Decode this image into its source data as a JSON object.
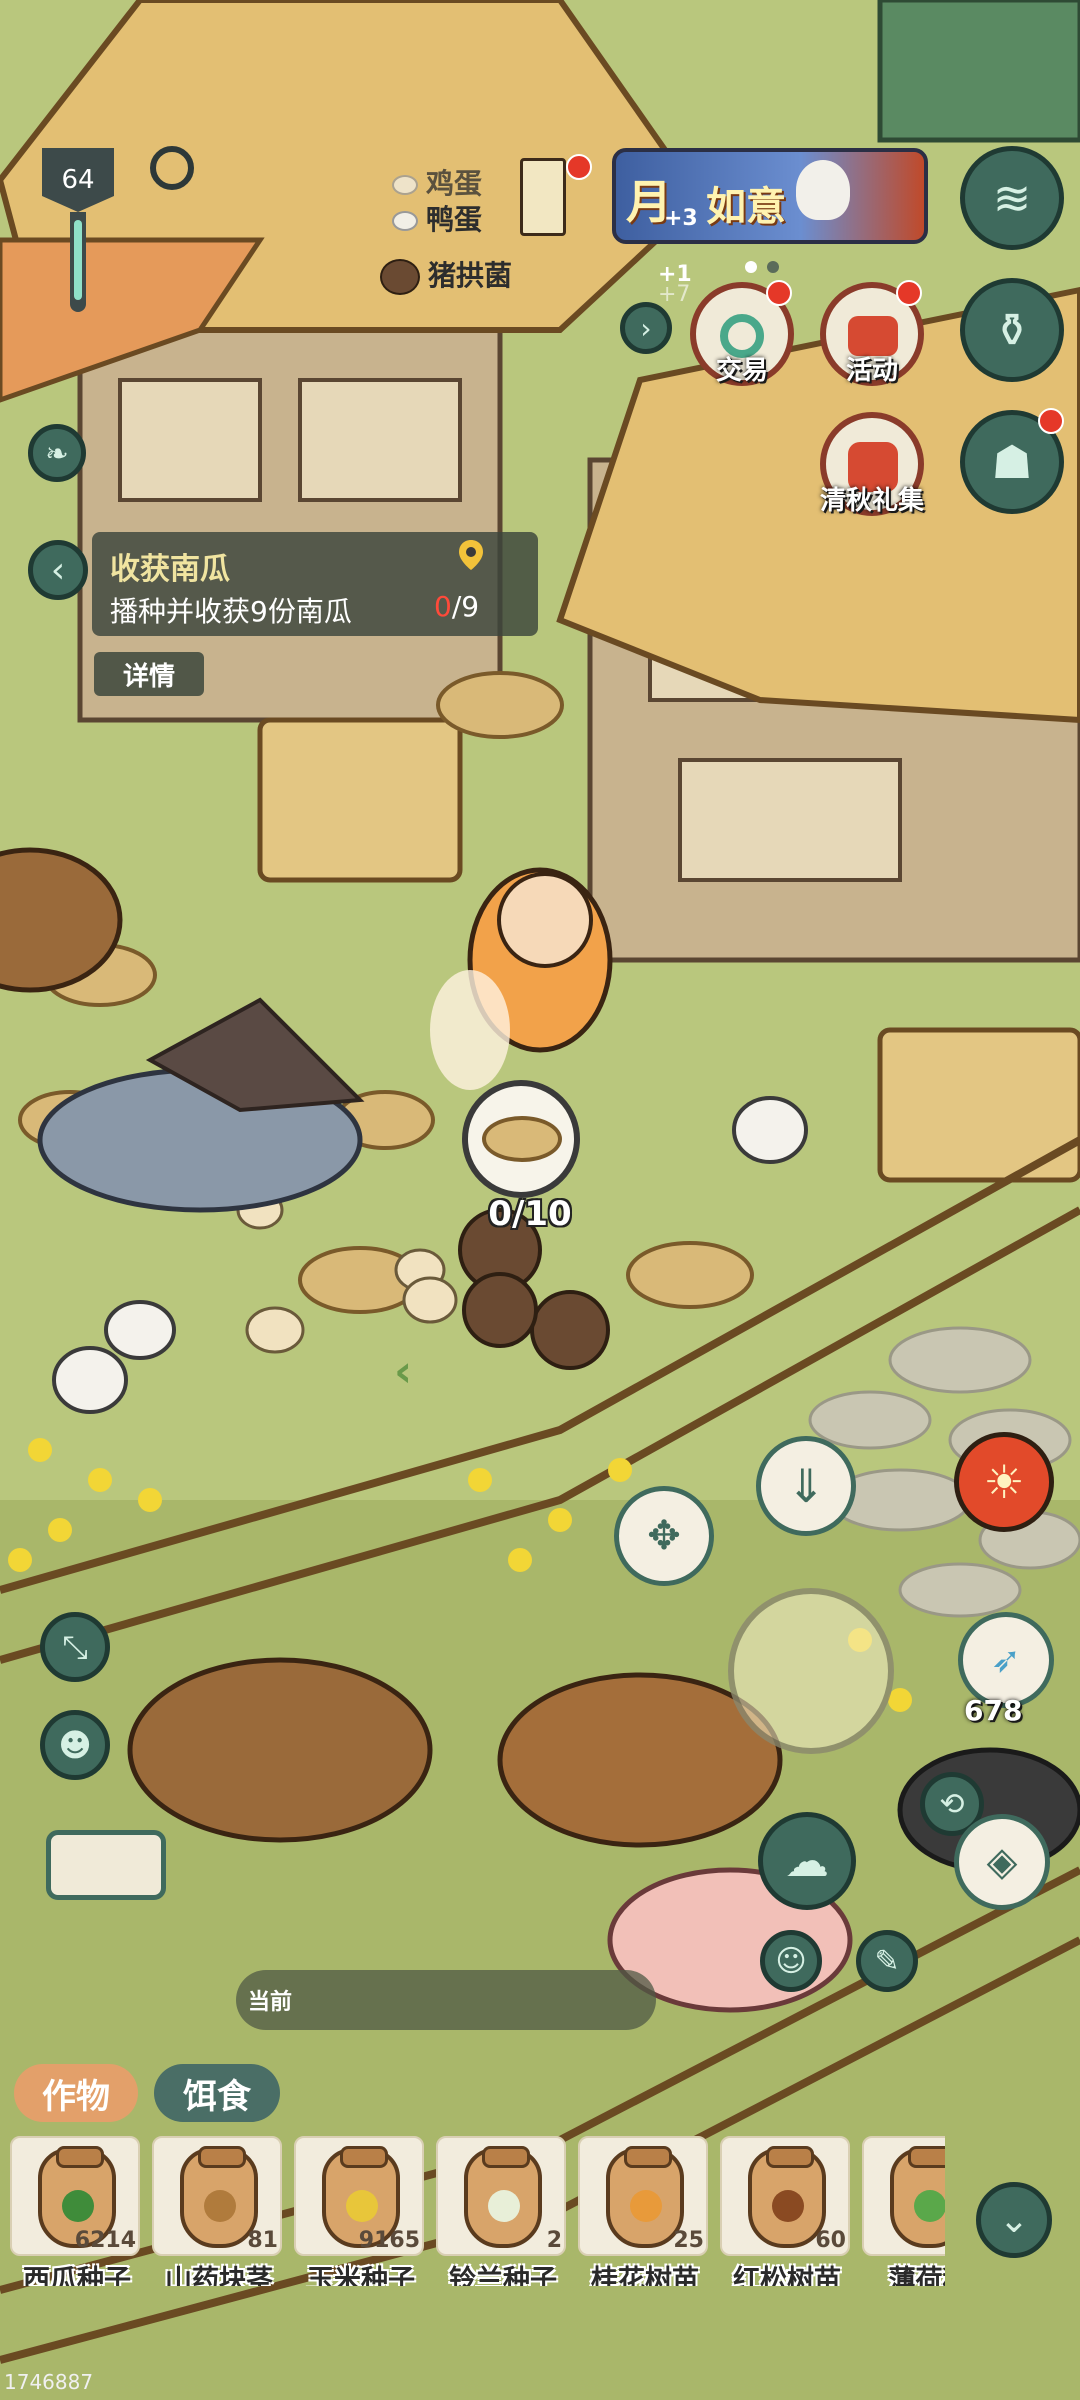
{
  "player": {
    "level": "64"
  },
  "resources": [
    {
      "name": "鸡蛋",
      "icon": "chicken-egg-icon"
    },
    {
      "name": "鸭蛋",
      "icon": "duck-egg-icon"
    },
    {
      "name": "猪拱菌",
      "icon": "truffle-icon"
    }
  ],
  "ghost_text": {
    "plus1": "+1",
    "plus7": "+7"
  },
  "event_banner": {
    "text_a": "月",
    "text_b": "如意",
    "bonus": "+3"
  },
  "menu": {
    "trade": "交易",
    "activity": "活动",
    "autumn_gift": "清秋礼集"
  },
  "quest": {
    "title": "收获南瓜",
    "description": "播种并收获9份南瓜",
    "progress_current": "0",
    "progress_total": "/9",
    "details": "详情"
  },
  "nest": {
    "count": "0/10"
  },
  "skill_count": "678",
  "bottom": {
    "current_label": "当前",
    "tabs": [
      "作物",
      "饵食"
    ],
    "items": [
      {
        "name": "西瓜种子",
        "count": "6214",
        "mark": "#3f8c3a"
      },
      {
        "name": "山药块茎",
        "count": "81",
        "mark": "#b07b3c"
      },
      {
        "name": "玉米种子",
        "count": "9165",
        "mark": "#e8c63a"
      },
      {
        "name": "铃兰种子",
        "count": "2",
        "mark": "#e8efd8"
      },
      {
        "name": "桂花树苗",
        "count": "25",
        "mark": "#e89a3a"
      },
      {
        "name": "红松树苗",
        "count": "60",
        "mark": "#8a4a22"
      },
      {
        "name": "薄荷种",
        "count": "",
        "mark": "#5aa84a"
      }
    ]
  },
  "uid": "1746887",
  "colors": {
    "grass": "#b9c77d",
    "accent_red": "#e53828",
    "hud_dark": "#3d4a4a"
  }
}
